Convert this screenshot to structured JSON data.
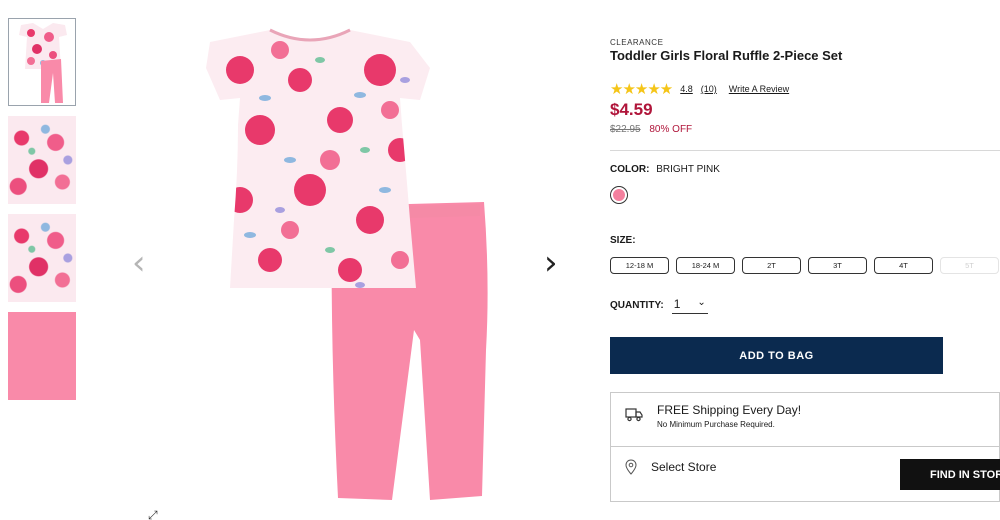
{
  "product": {
    "badge": "CLEARANCE",
    "title": "Toddler Girls Floral Ruffle 2-Piece Set",
    "rating": {
      "stars": "★★★★★",
      "value": "4.8",
      "count": "(10)",
      "write_review": "Write A Review"
    },
    "price": "$4.59",
    "original_price": "$22.95",
    "discount": "80% OFF"
  },
  "color": {
    "label": "COLOR:",
    "value": "BRIGHT PINK",
    "swatch_color": "#f4809e"
  },
  "size": {
    "label": "SIZE:",
    "options": [
      "12-18 M",
      "18-24 M",
      "2T",
      "3T",
      "4T",
      "5T"
    ]
  },
  "quantity": {
    "label": "QUANTITY:",
    "value": "1"
  },
  "actions": {
    "add_to_bag": "ADD TO BAG",
    "find_in_store": "FIND IN STORE"
  },
  "shipping": {
    "title": "FREE Shipping Every Day!",
    "subtitle": "No Minimum Purchase Required.",
    "select_store": "Select Store"
  },
  "gallery": {
    "prev_arrow": "‹",
    "next_arrow": "›",
    "expand": "⤢"
  },
  "colors": {
    "price_red": "#b0153a",
    "button_navy": "#0b2a4f",
    "top_pink": "#f05d8a",
    "pants_pink": "#f98aa9"
  }
}
